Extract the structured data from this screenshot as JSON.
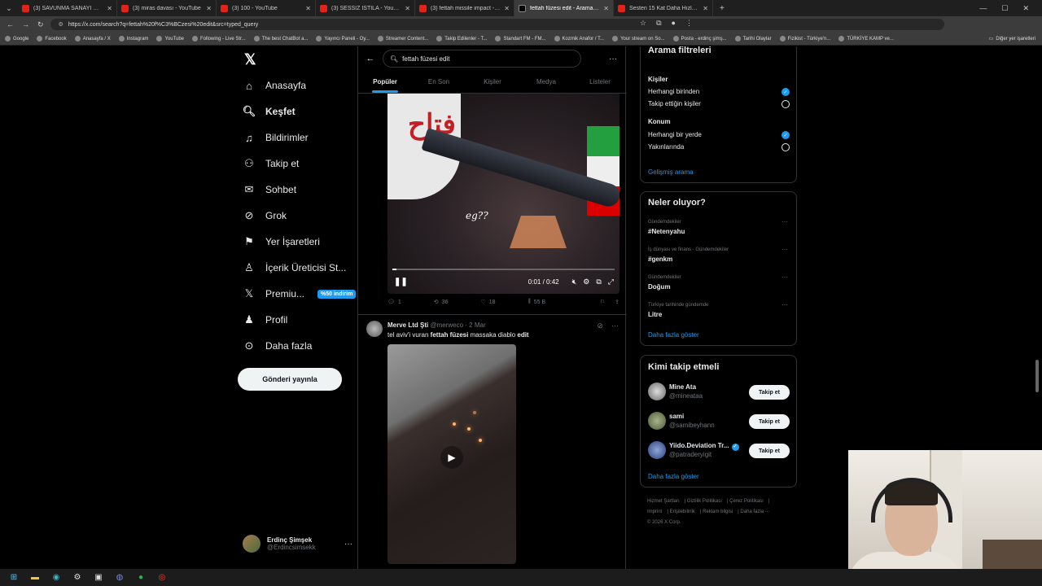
{
  "browser": {
    "tabs": [
      {
        "label": "(3) SAVUNMA SANAYİ UZMANI, İ...",
        "type": "yt"
      },
      {
        "label": "(3) miras davası - YouTube",
        "type": "yt"
      },
      {
        "label": "(3) 100 - YouTube",
        "type": "yt"
      },
      {
        "label": "(3) SESSİZ İSTİLA - YouTube",
        "type": "yt"
      },
      {
        "label": "(3) fettah missile impact - YouTube",
        "type": "yt"
      },
      {
        "label": "fettah füzesi edit - Arama / X",
        "type": "x",
        "active": true
      },
      {
        "label": "Sesten 15 Kat Daha Hızlı Fettah H...",
        "type": "yt"
      }
    ],
    "url": "https://x.com/search?q=fettah%20f%C3%BCzesi%20edit&src=typed_query",
    "bookmarks": [
      "Google",
      "Facebook",
      "Anasayfa / X",
      "Instagram",
      "YouTube",
      "Following - Live Str...",
      "The best ChatBot a...",
      "Yayıncı Paneli - Oy...",
      "Streamer Content...",
      "Takip Edilenler - T...",
      "Standart FM - FM...",
      "Kozmik Anafor / T...",
      "Your stream on So...",
      "Posta - erdinç şimş...",
      "Tarihi Olaylar",
      "Fizikist - Türkiye'n...",
      "TÜRKİYE KAMP ve..."
    ],
    "other_bookmarks": "Diğer yer işaretleri"
  },
  "nav": {
    "items": [
      "Anasayfa",
      "Keşfet",
      "Bildirimler",
      "Takip et",
      "Sohbet",
      "Grok",
      "Yer İşaretleri",
      "İçerik Üreticisi St...",
      "Premiu...",
      "Profil",
      "Daha fazla"
    ],
    "premium_badge": "%50 indirim",
    "post_button": "Gönderi yayınla",
    "account_name": "Erdinç Şimşek",
    "account_handle": "@Erdincsimsekk"
  },
  "search": {
    "query": "fettah füzesi edit",
    "tabs": [
      "Popüler",
      "En Son",
      "Kişiler",
      "Medya",
      "Listeler"
    ]
  },
  "tweet1": {
    "video_time": "0:01 / 0:42",
    "video_progress": 0.02,
    "video_tag": "eg??",
    "replies": "1",
    "reposts": "36",
    "likes": "18",
    "views": "55 B"
  },
  "tweet2": {
    "name": "Merve Ltd Şti",
    "handle": "@merweco",
    "date": "· 2 Mar",
    "text_pre": "tel aviv'i vuran ",
    "text_bold": "fettah füzesi",
    "text_mid": " massaka diablo ",
    "text_bold2": "edit"
  },
  "filters": {
    "title": "Arama filtreleri",
    "people_label": "Kişiler",
    "people_opt1": "Herhangi birinden",
    "people_opt2": "Takip ettiğin kişiler",
    "location_label": "Konum",
    "loc_opt1": "Herhangi bir yerde",
    "loc_opt2": "Yakınlarında",
    "advanced": "Gelişmiş arama"
  },
  "trends": {
    "title": "Neler oluyor?",
    "items": [
      {
        "context": "Gündemdekiler",
        "name": "#Netenyahu"
      },
      {
        "context": "İş dünyası ve finans · Gündemdekiler",
        "name": "#genkm"
      },
      {
        "context": "Gündemdekiler",
        "name": "Doğum"
      },
      {
        "context": "Türkiye tarihinde gündemde",
        "name": "Litre"
      }
    ],
    "show_more": "Daha fazla göster"
  },
  "who_to_follow": {
    "title": "Kimi takip etmeli",
    "users": [
      {
        "name": "Mine Ata",
        "handle": "@mineataa",
        "button": "Takip et"
      },
      {
        "name": "sami",
        "handle": "@samibeyhann",
        "button": "Takip et"
      },
      {
        "name": "Yiido.Deviation Tr...",
        "handle": "@patraderyigit",
        "button": "Takip et"
      }
    ],
    "show_more": "Daha fazla göster"
  },
  "footer": [
    "Hizmet Şartları",
    "Gizlilik Politikası",
    "Çerez Politikası",
    "Imprint",
    "Erişilebilirlik",
    "Reklam bilgisi",
    "Daha fazla ···",
    "© 2026 X Corp."
  ],
  "colors": {
    "accent": "#1d9bf0",
    "bg": "#000000",
    "border": "#2f3336"
  }
}
